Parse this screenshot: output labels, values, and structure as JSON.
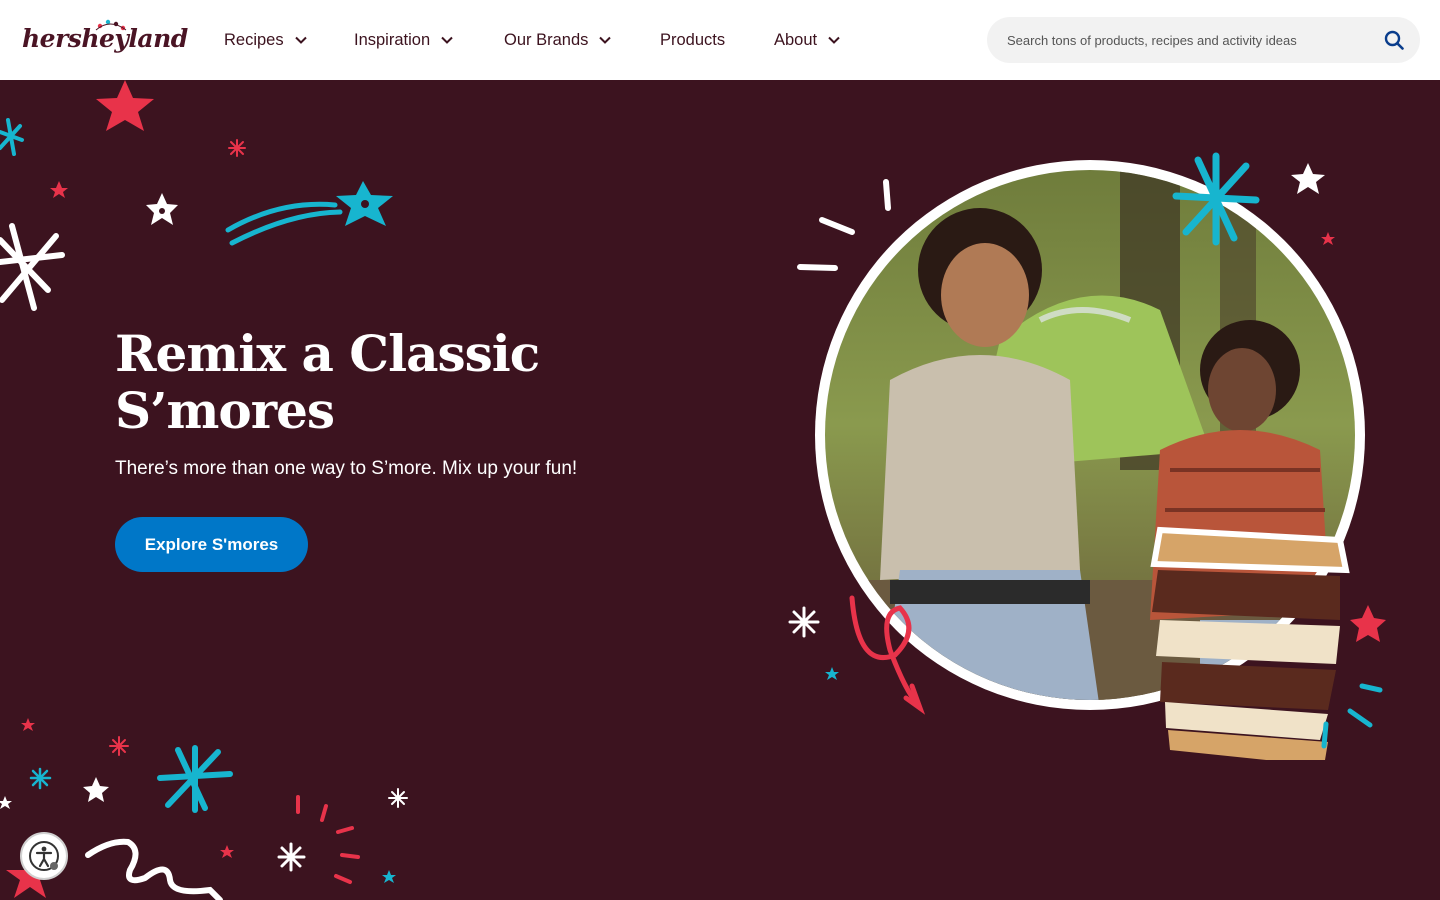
{
  "brand": {
    "name": "hersheyland"
  },
  "nav": {
    "items": [
      {
        "label": "Recipes",
        "has_dropdown": true
      },
      {
        "label": "Inspiration",
        "has_dropdown": true
      },
      {
        "label": "Our Brands",
        "has_dropdown": true
      },
      {
        "label": "Products",
        "has_dropdown": false
      },
      {
        "label": "About",
        "has_dropdown": true
      }
    ]
  },
  "search": {
    "placeholder": "Search tons of products, recipes and activity ideas",
    "icon": "search-icon"
  },
  "hero": {
    "title_line1": "Remix a Classic",
    "title_line2": "S’mores",
    "subtitle": "There’s more than one way to S’more. Mix up your fun!",
    "cta_label": "Explore S'mores"
  },
  "accessibility": {
    "icon": "accessibility-icon"
  },
  "colors": {
    "background": "#3c131f",
    "header": "#ffffff",
    "accent_blue": "#0077c8",
    "brand_text": "#4a1424",
    "star_red": "#e8334a",
    "star_cyan": "#17b5cf"
  }
}
